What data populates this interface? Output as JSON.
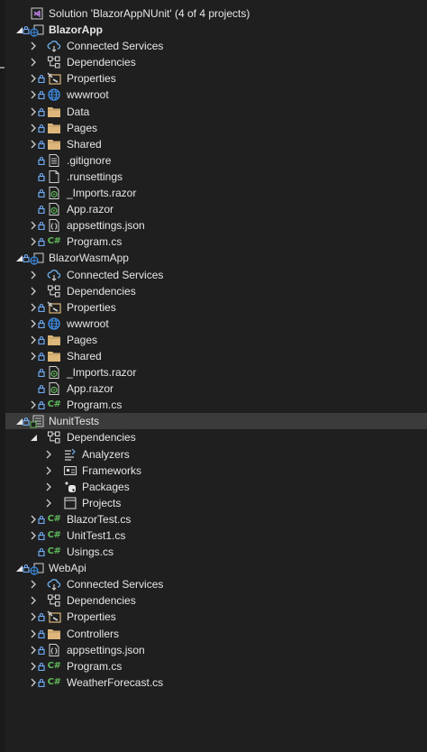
{
  "colors": {
    "background": "#1f1f1f",
    "selected_row": "#3b3b3b",
    "text": "#e6e6e6",
    "folder": "#dcb67a",
    "csharp": "#5fb85b",
    "lock": "#6fa8f0",
    "globe": "#3d8ee6"
  },
  "rows": [
    {
      "label": "Solution 'BlazorAppNUnit' (4 of 4 projects)",
      "icon": "solution-icon",
      "expander": "none",
      "lock": false,
      "level": 0
    },
    {
      "label": "BlazorApp",
      "icon": "web-project-icon",
      "expander": "expanded",
      "lock": true,
      "level": 0,
      "bold": true
    },
    {
      "label": "Connected Services",
      "icon": "connected-services-icon",
      "expander": "collapsed",
      "lock": false,
      "level": 1
    },
    {
      "label": "Dependencies",
      "icon": "dependencies-icon",
      "expander": "collapsed",
      "lock": false,
      "level": 1
    },
    {
      "label": "Properties",
      "icon": "properties-icon",
      "expander": "collapsed",
      "lock": true,
      "level": 1
    },
    {
      "label": "wwwroot",
      "icon": "globe-icon",
      "expander": "collapsed",
      "lock": true,
      "level": 1
    },
    {
      "label": "Data",
      "icon": "folder-icon",
      "expander": "collapsed",
      "lock": true,
      "level": 1
    },
    {
      "label": "Pages",
      "icon": "folder-icon",
      "expander": "collapsed",
      "lock": true,
      "level": 1
    },
    {
      "label": "Shared",
      "icon": "folder-icon",
      "expander": "collapsed",
      "lock": true,
      "level": 1
    },
    {
      "label": ".gitignore",
      "icon": "text-file-icon",
      "expander": "none",
      "lock": true,
      "level": 1
    },
    {
      "label": ".runsettings",
      "icon": "file-icon",
      "expander": "none",
      "lock": true,
      "level": 1
    },
    {
      "label": "_Imports.razor",
      "icon": "razor-file-icon",
      "expander": "none",
      "lock": true,
      "level": 1
    },
    {
      "label": "App.razor",
      "icon": "razor-file-icon",
      "expander": "none",
      "lock": true,
      "level": 1
    },
    {
      "label": "appsettings.json",
      "icon": "json-file-icon",
      "expander": "collapsed",
      "lock": true,
      "level": 1
    },
    {
      "label": "Program.cs",
      "icon": "csharp-file-icon",
      "expander": "collapsed",
      "lock": true,
      "level": 1
    },
    {
      "label": "BlazorWasmApp",
      "icon": "web-project-icon",
      "expander": "expanded",
      "lock": true,
      "level": 0
    },
    {
      "label": "Connected Services",
      "icon": "connected-services-icon",
      "expander": "collapsed",
      "lock": false,
      "level": 1
    },
    {
      "label": "Dependencies",
      "icon": "dependencies-icon",
      "expander": "collapsed",
      "lock": false,
      "level": 1
    },
    {
      "label": "Properties",
      "icon": "properties-icon",
      "expander": "collapsed",
      "lock": true,
      "level": 1
    },
    {
      "label": "wwwroot",
      "icon": "globe-icon",
      "expander": "collapsed",
      "lock": true,
      "level": 1
    },
    {
      "label": "Pages",
      "icon": "folder-icon",
      "expander": "collapsed",
      "lock": true,
      "level": 1
    },
    {
      "label": "Shared",
      "icon": "folder-icon",
      "expander": "collapsed",
      "lock": true,
      "level": 1
    },
    {
      "label": "_Imports.razor",
      "icon": "razor-file-icon",
      "expander": "none",
      "lock": true,
      "level": 1
    },
    {
      "label": "App.razor",
      "icon": "razor-file-icon",
      "expander": "none",
      "lock": true,
      "level": 1
    },
    {
      "label": "Program.cs",
      "icon": "csharp-file-icon",
      "expander": "collapsed",
      "lock": true,
      "level": 1
    },
    {
      "label": "NunitTests",
      "icon": "test-project-icon",
      "expander": "expanded",
      "lock": true,
      "level": 0,
      "selected": true
    },
    {
      "label": "Dependencies",
      "icon": "dependencies-icon",
      "expander": "expanded",
      "lock": false,
      "level": 1
    },
    {
      "label": "Analyzers",
      "icon": "analyzers-icon",
      "expander": "collapsed",
      "lock": false,
      "level": 2
    },
    {
      "label": "Frameworks",
      "icon": "frameworks-icon",
      "expander": "collapsed",
      "lock": false,
      "level": 2
    },
    {
      "label": "Packages",
      "icon": "packages-icon",
      "expander": "collapsed",
      "lock": false,
      "level": 2
    },
    {
      "label": "Projects",
      "icon": "projects-icon",
      "expander": "collapsed",
      "lock": false,
      "level": 2
    },
    {
      "label": "BlazorTest.cs",
      "icon": "csharp-file-icon",
      "expander": "collapsed",
      "lock": true,
      "level": 1
    },
    {
      "label": "UnitTest1.cs",
      "icon": "csharp-file-icon",
      "expander": "collapsed",
      "lock": true,
      "level": 1
    },
    {
      "label": "Usings.cs",
      "icon": "csharp-file-icon",
      "expander": "none",
      "lock": true,
      "level": 1
    },
    {
      "label": "WebApi",
      "icon": "web-project-icon",
      "expander": "expanded",
      "lock": true,
      "level": 0
    },
    {
      "label": "Connected Services",
      "icon": "connected-services-icon",
      "expander": "collapsed",
      "lock": false,
      "level": 1
    },
    {
      "label": "Dependencies",
      "icon": "dependencies-icon",
      "expander": "collapsed",
      "lock": false,
      "level": 1
    },
    {
      "label": "Properties",
      "icon": "properties-icon",
      "expander": "collapsed",
      "lock": true,
      "level": 1
    },
    {
      "label": "Controllers",
      "icon": "folder-icon",
      "expander": "collapsed",
      "lock": true,
      "level": 1
    },
    {
      "label": "appsettings.json",
      "icon": "json-file-icon",
      "expander": "collapsed",
      "lock": true,
      "level": 1
    },
    {
      "label": "Program.cs",
      "icon": "csharp-file-icon",
      "expander": "collapsed",
      "lock": true,
      "level": 1
    },
    {
      "label": "WeatherForecast.cs",
      "icon": "csharp-file-icon",
      "expander": "collapsed",
      "lock": true,
      "level": 1
    }
  ]
}
